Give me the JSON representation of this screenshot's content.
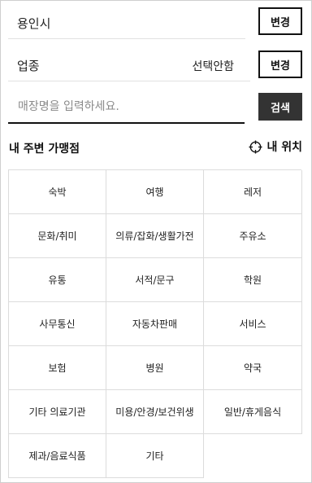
{
  "region": {
    "value": "용인시",
    "change_label": "변경"
  },
  "business_type": {
    "label": "업종",
    "value": "선택안함",
    "change_label": "변경"
  },
  "search": {
    "placeholder": "매장명을 입력하세요.",
    "button_label": "검색"
  },
  "nearby": {
    "title": "내 주변 가맹점",
    "my_location_label": "내 위치"
  },
  "categories": [
    "숙박",
    "여행",
    "레저",
    "문화/취미",
    "의류/잡화/생활가전",
    "주유소",
    "유통",
    "서적/문구",
    "학원",
    "사무통신",
    "자동차판매",
    "서비스",
    "보험",
    "병원",
    "약국",
    "기타 의료기관",
    "미용/안경/보건위생",
    "일반/휴게음식",
    "제과/음료식품",
    "기타"
  ]
}
